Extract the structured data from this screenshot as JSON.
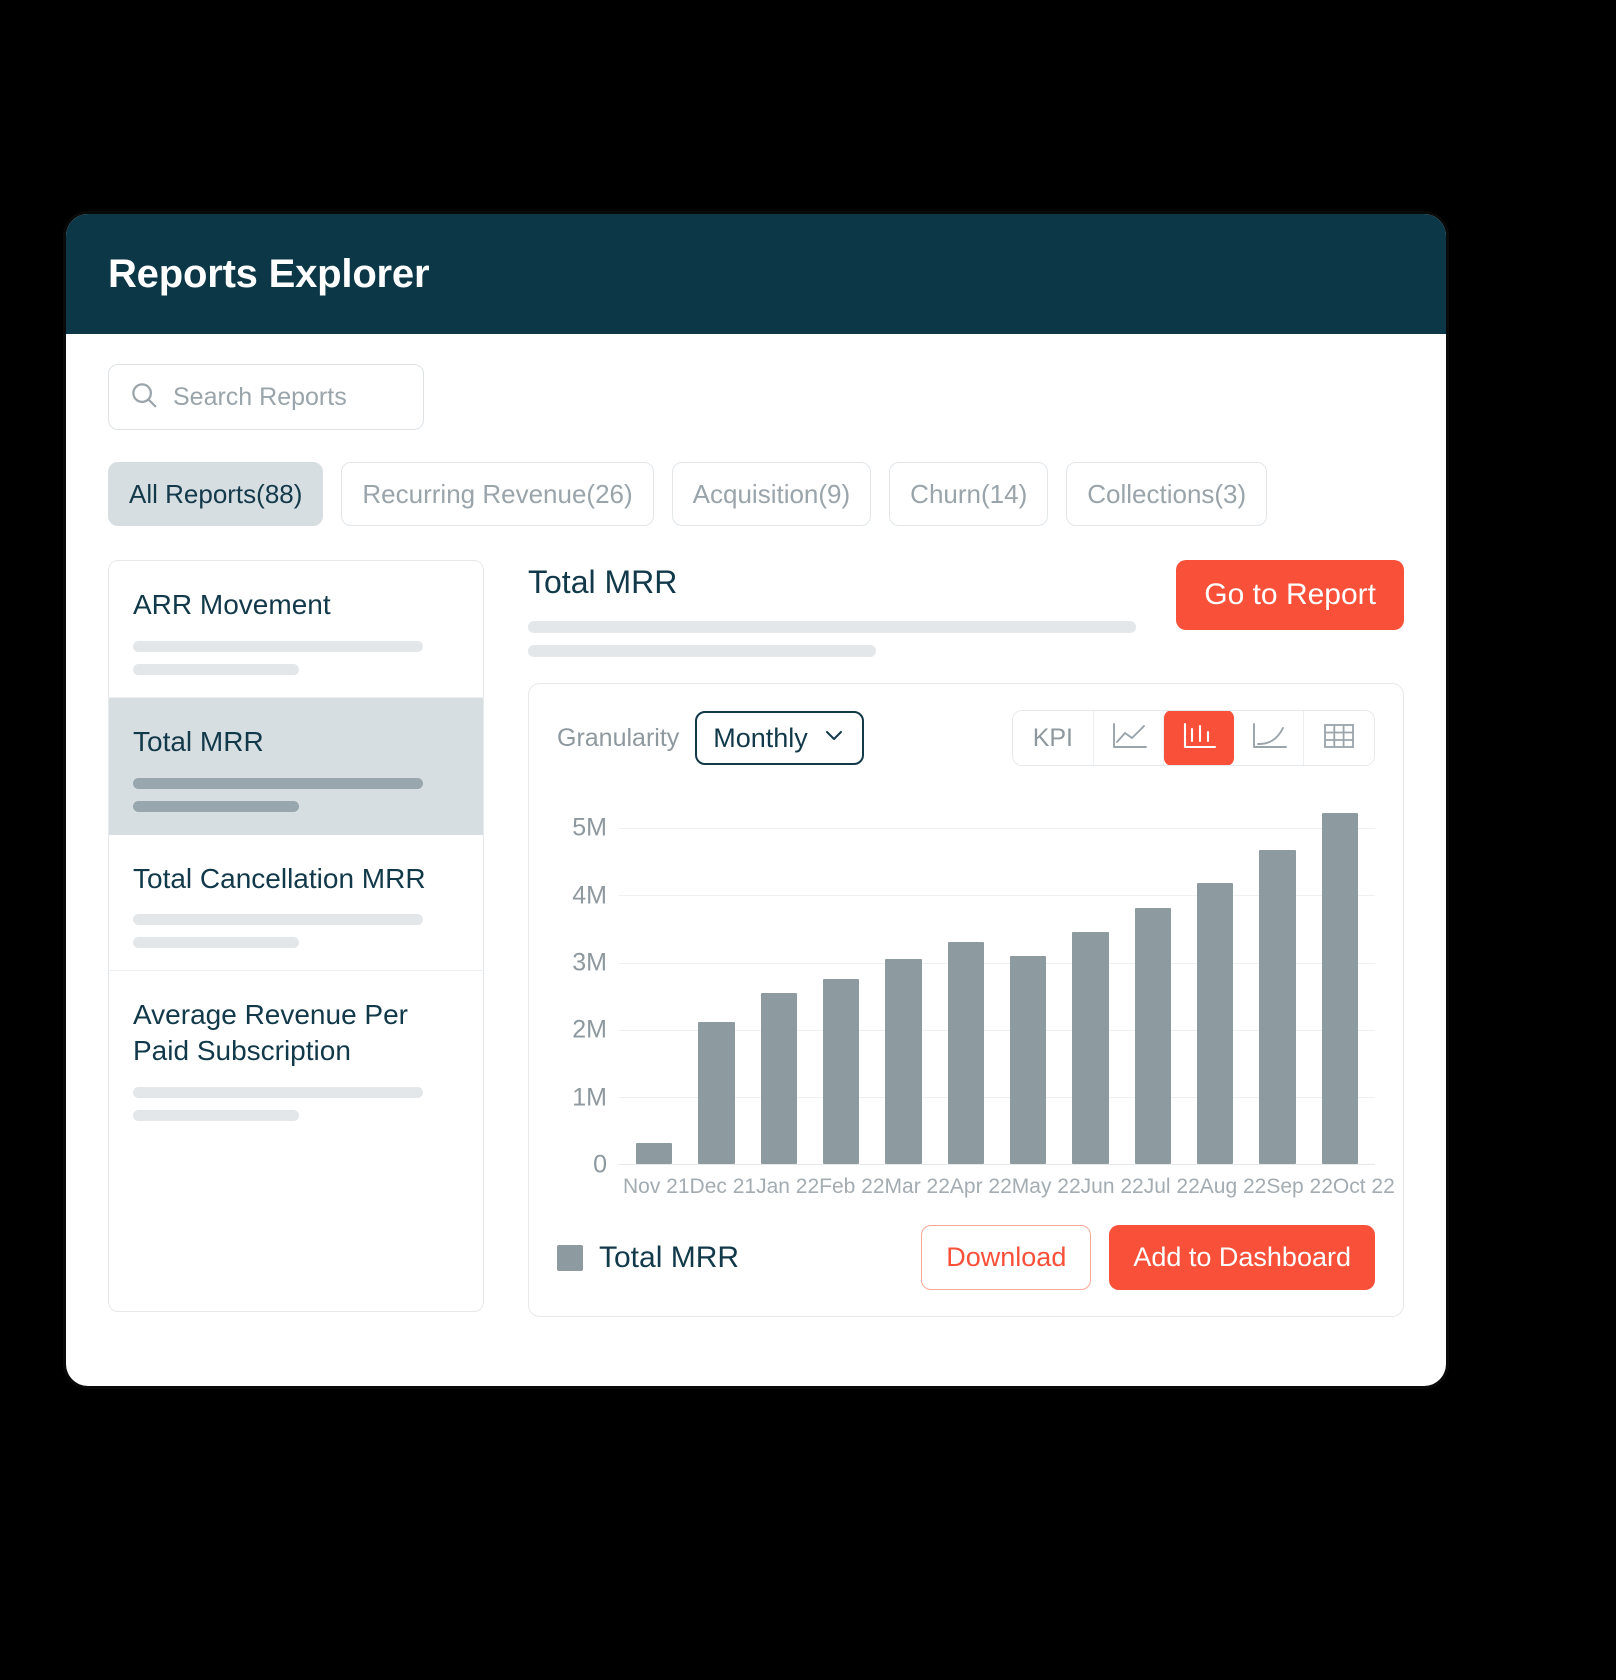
{
  "window": {
    "title": "Reports Explorer",
    "header_bg": "#0c3746",
    "accent": "#f9503a"
  },
  "search": {
    "placeholder": "Search Reports",
    "value": "",
    "icon": "search-icon"
  },
  "filters": [
    {
      "label": "All Reports(88)",
      "active": true
    },
    {
      "label": "Recurring Revenue(26)",
      "active": false
    },
    {
      "label": "Acquisition(9)",
      "active": false
    },
    {
      "label": "Churn(14)",
      "active": false
    },
    {
      "label": "Collections(3)",
      "active": false
    }
  ],
  "reports": [
    {
      "title": "ARR Movement",
      "selected": false
    },
    {
      "title": "Total MRR",
      "selected": true
    },
    {
      "title": "Total Cancellation MRR",
      "selected": false
    },
    {
      "title": "Average Revenue Per Paid Subscription",
      "selected": false
    }
  ],
  "detail": {
    "title": "Total MRR",
    "go_to_report_label": "Go to Report"
  },
  "controls": {
    "granularity_label": "Granularity",
    "granularity_value": "Monthly",
    "chevron_icon": "chevron-down-icon",
    "views": [
      {
        "label": "KPI",
        "icon": "kpi-text",
        "active": false
      },
      {
        "label": "",
        "icon": "line-chart-icon",
        "active": false
      },
      {
        "label": "",
        "icon": "bar-chart-icon",
        "active": true
      },
      {
        "label": "",
        "icon": "area-chart-icon",
        "active": false
      },
      {
        "label": "",
        "icon": "table-icon",
        "active": false
      }
    ]
  },
  "footer": {
    "legend_label": "Total MRR",
    "download_label": "Download",
    "add_to_dashboard_label": "Add to Dashboard"
  },
  "chart_data": {
    "type": "bar",
    "title": "Total MRR",
    "xlabel": "",
    "ylabel": "",
    "ylim": [
      0,
      5600000
    ],
    "grid": true,
    "legend_position": "bottom-left",
    "series_color": "#8d9ba1",
    "y_ticks": [
      {
        "label": "0",
        "value": 0
      },
      {
        "label": "1M",
        "value": 1000000
      },
      {
        "label": "2M",
        "value": 2000000
      },
      {
        "label": "3M",
        "value": 3000000
      },
      {
        "label": "4M",
        "value": 4000000
      },
      {
        "label": "5M",
        "value": 5000000
      }
    ],
    "categories": [
      "Nov 21",
      "Dec 21",
      "Jan 22",
      "Feb 22",
      "Mar 22",
      "Apr 22",
      "May 22",
      "Jun 22",
      "Jul 22",
      "Aug 22",
      "Sep 22",
      "Oct 22"
    ],
    "series": [
      {
        "name": "Total MRR",
        "values": [
          310000,
          2120000,
          2540000,
          2750000,
          3060000,
          3310000,
          3100000,
          3450000,
          3810000,
          4190000,
          4670000,
          5230000
        ]
      }
    ]
  }
}
